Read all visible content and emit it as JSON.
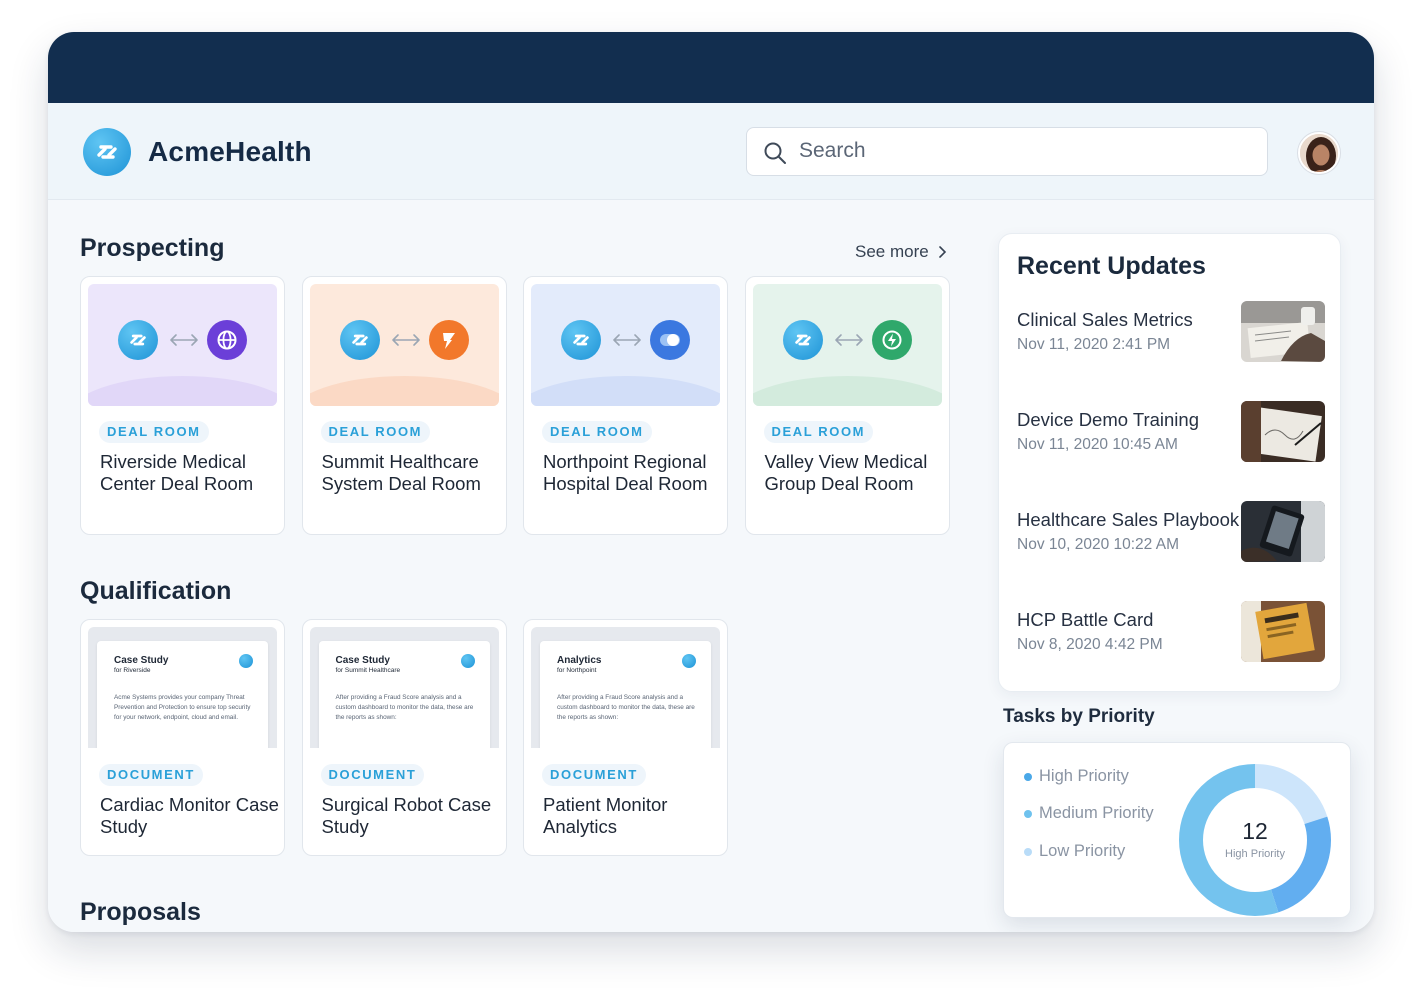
{
  "app": {
    "brand": "AcmeHealth"
  },
  "search": {
    "placeholder": "Search",
    "value": ""
  },
  "prospecting": {
    "title": "Prospecting",
    "see_more": "See more",
    "cards": [
      {
        "tag": "DEAL ROOM",
        "title": "Riverside Medical Center Deal Room",
        "partner_icon": "globe-icon",
        "theme": "#ece6fb",
        "wave": "#e1d7f8",
        "partner_color": "#6b3fd8"
      },
      {
        "tag": "DEAL ROOM",
        "title": "Summit Healthcare System Deal Room",
        "partner_icon": "bolt-flag-icon",
        "theme": "#fde9dc",
        "wave": "#fbd9c5",
        "partner_color": "#f2782b"
      },
      {
        "tag": "DEAL ROOM",
        "title": "Northpoint Regional Hospital Deal Room",
        "partner_icon": "cloud-toggle-icon",
        "theme": "#e3ebfb",
        "wave": "#d2def8",
        "partner_color": "#3b78e0"
      },
      {
        "tag": "DEAL ROOM",
        "title": "Valley View Medical Group Deal Room",
        "partner_icon": "bolt-circle-icon",
        "theme": "#e5f3ec",
        "wave": "#d3ebdd",
        "partner_color": "#2fa86b"
      }
    ]
  },
  "qualification": {
    "title": "Qualification",
    "cards": [
      {
        "tag": "DOCUMENT",
        "title": "Cardiac Monitor Case Study",
        "doc_title": "Case Study",
        "doc_subtitle": "for Riverside",
        "doc_body": "Acme Systems provides your company Threat Prevention and Protection to ensure top security for your network, endpoint, cloud and email."
      },
      {
        "tag": "DOCUMENT",
        "title": "Surgical Robot Case Study",
        "doc_title": "Case Study",
        "doc_subtitle": "for Summit Healthcare",
        "doc_body": "After providing a Fraud Score analysis and a custom dashboard to monitor the data, these are the reports as shown:"
      },
      {
        "tag": "DOCUMENT",
        "title": "Patient Monitor Analytics",
        "doc_title": "Analytics",
        "doc_subtitle": "for Northpoint",
        "doc_body": "After providing a Fraud Score analysis and a custom dashboard to monitor the data, these are the reports as shown:"
      }
    ]
  },
  "proposals": {
    "title": "Proposals"
  },
  "recent_updates": {
    "title": "Recent Updates",
    "items": [
      {
        "title": "Clinical Sales Metrics",
        "date": "Nov 11, 2020  2:41 PM",
        "image": "writing-desk-photo"
      },
      {
        "title": "Device Demo Training",
        "date": "Nov 11, 2020  10:45 AM",
        "image": "sketch-drawing-photo"
      },
      {
        "title": "Healthcare Sales Playbook",
        "date": "Nov 10, 2020  10:22 AM",
        "image": "ereader-photo"
      },
      {
        "title": "HCP Battle Card",
        "date": "Nov 8, 2020  4:42 PM",
        "image": "folder-documents-photo"
      }
    ]
  },
  "tasks": {
    "title": "Tasks by Priority",
    "legend": [
      {
        "label": "High Priority",
        "color": "#4aa8e8"
      },
      {
        "label": "Medium Priority",
        "color": "#6fc2ee"
      },
      {
        "label": "Low Priority",
        "color": "#b9dcf8"
      }
    ],
    "center_value": "12",
    "center_label": "High Priority",
    "segments": [
      {
        "label": "Low Priority",
        "fraction": 0.2,
        "color": "#cde5fb"
      },
      {
        "label": "Medium Priority",
        "fraction": 0.25,
        "color": "#62aef0"
      },
      {
        "label": "High Priority",
        "fraction": 0.55,
        "color": "#74c3ee"
      }
    ]
  }
}
